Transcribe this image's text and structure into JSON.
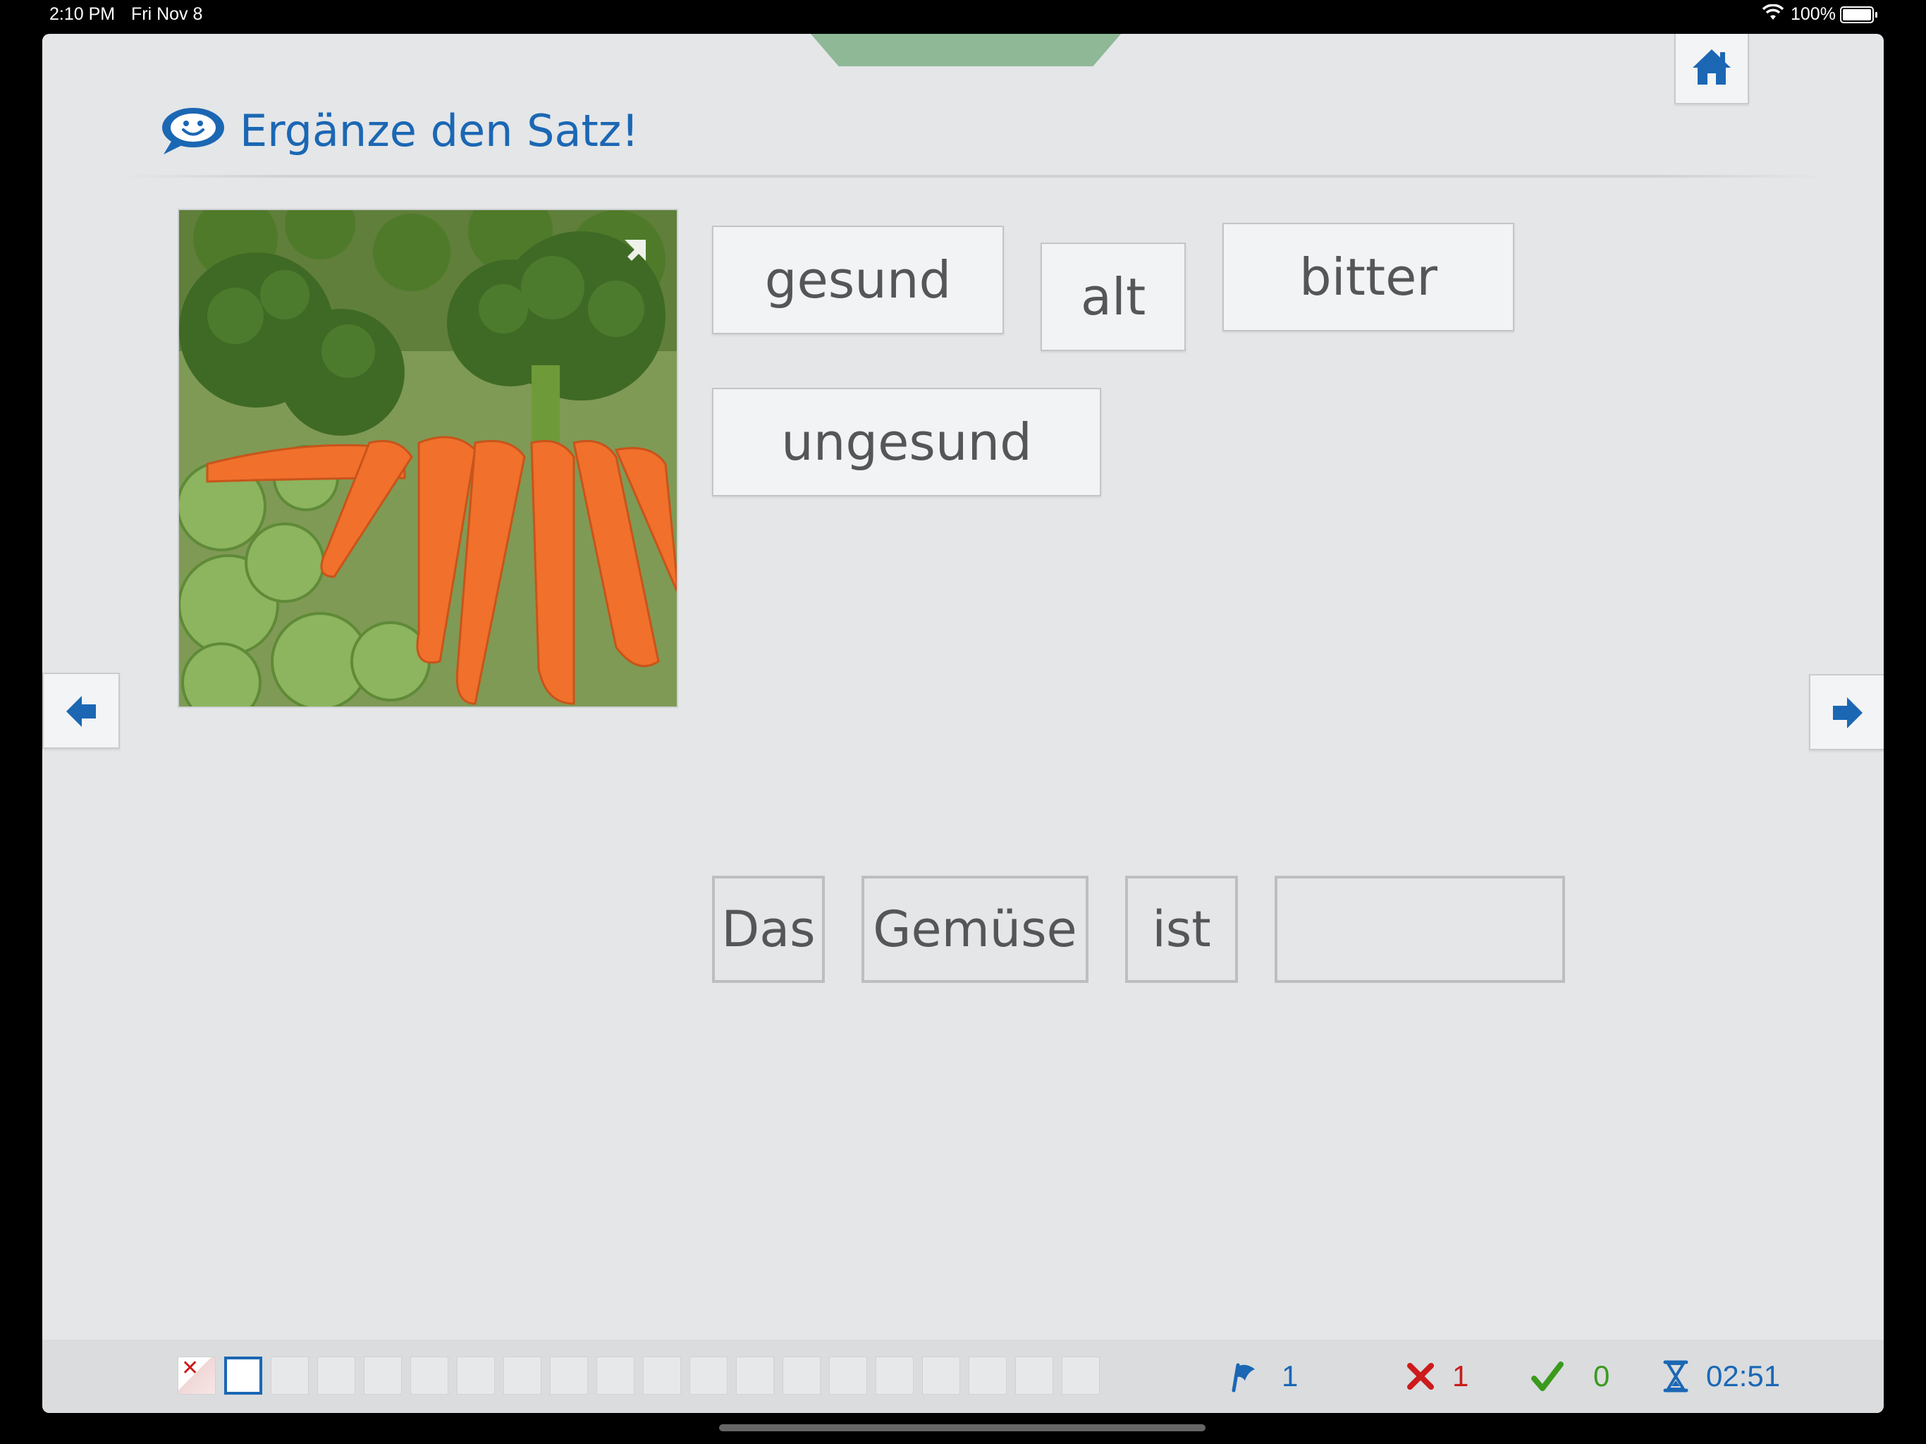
{
  "status_bar": {
    "time": "2:10 PM",
    "date": "Fri Nov 8",
    "battery": "100%"
  },
  "header": {
    "title": "Ergänze den Satz!"
  },
  "words": [
    "gesund",
    "alt",
    "bitter",
    "ungesund"
  ],
  "sentence": {
    "word1": "Das",
    "word2": "Gemüse",
    "word3": "ist",
    "blank": ""
  },
  "progress": {
    "total": 20,
    "current_index": 1,
    "wrong_index": 0
  },
  "stats": {
    "flags": "1",
    "wrong": "1",
    "correct": "0",
    "time": "02:51"
  },
  "colors": {
    "accent": "#1b67b4",
    "wrong": "#cc1b1b",
    "correct": "#3a9a1c",
    "tab": "#8fb896"
  },
  "icons": [
    "speech-bubble-icon",
    "home-icon",
    "arrow-left-icon",
    "arrow-right-icon",
    "expand-icon",
    "flag-icon",
    "x-icon",
    "check-icon",
    "hourglass-icon"
  ]
}
